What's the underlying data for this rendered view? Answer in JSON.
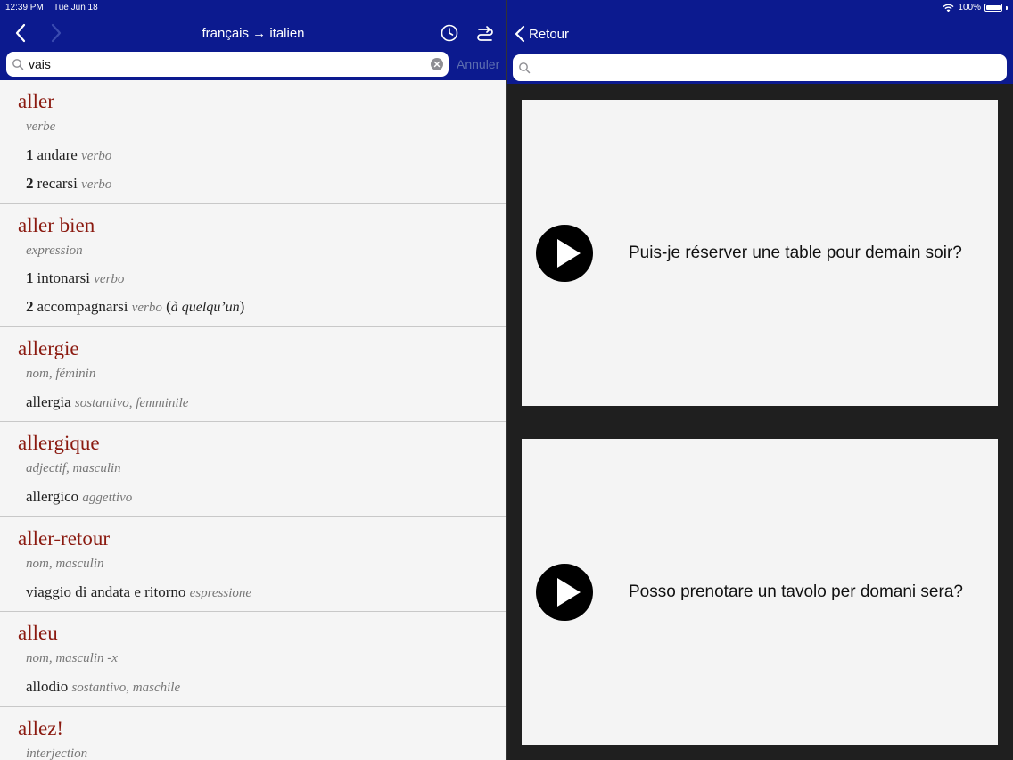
{
  "status": {
    "time": "12:39 PM",
    "date": "Tue Jun 18",
    "battery": "100%"
  },
  "left": {
    "title": "français → italien",
    "search_value": "vais",
    "cancel_label": "Annuler",
    "entries": [
      {
        "headword": "aller",
        "pos": "verbe",
        "senses": [
          {
            "num": "1",
            "text": "andare",
            "gram": "verbo"
          },
          {
            "num": "2",
            "text": "recarsi",
            "gram": "verbo"
          }
        ]
      },
      {
        "headword": "aller bien",
        "pos": "expression",
        "senses": [
          {
            "num": "1",
            "text": "intonarsi",
            "gram": "verbo"
          },
          {
            "num": "2",
            "text": "accompagnarsi",
            "gram": "verbo",
            "ctx_open": "(",
            "ctx": "à quelqu’un",
            "ctx_close": ")"
          }
        ]
      },
      {
        "headword": "allergie",
        "pos": "nom, féminin",
        "senses": [
          {
            "text": "allergia",
            "gram": "sostantivo, femminile"
          }
        ]
      },
      {
        "headword": "allergique",
        "pos": "adjectif, masculin",
        "senses": [
          {
            "text": "allergico",
            "gram": "aggettivo"
          }
        ]
      },
      {
        "headword": "aller-retour",
        "pos": "nom, masculin",
        "senses": [
          {
            "text": "viaggio di andata e ritorno",
            "gram": "espressione"
          }
        ]
      },
      {
        "headword": "alleu",
        "pos": "nom, masculin -x",
        "senses": [
          {
            "text": "allodio",
            "gram": "sostantivo, maschile"
          }
        ]
      },
      {
        "headword": "allez!",
        "pos": "interjection",
        "senses": []
      }
    ]
  },
  "right": {
    "back_label": "Retour",
    "search_placeholder": "",
    "phrases": [
      {
        "text": "Puis-je réserver une table pour demain soir?"
      },
      {
        "text": "Posso prenotare un tavolo per domani sera?"
      }
    ]
  },
  "colors": {
    "header": "#0c1a8f",
    "headword": "#8b1a10",
    "panel_bg": "#1f1f1f"
  }
}
